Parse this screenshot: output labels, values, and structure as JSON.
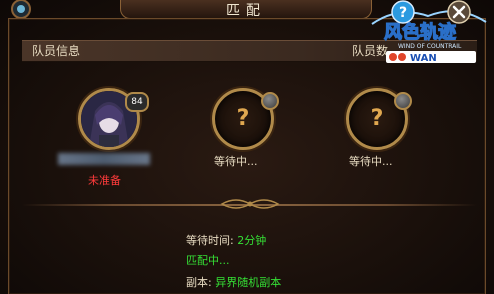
{
  "window": {
    "title": "匹配"
  },
  "section": {
    "title": "队员信息",
    "right_text": "队员数"
  },
  "slots": [
    {
      "level": "84",
      "status": "未准备"
    },
    {
      "label": "等待中..."
    },
    {
      "label": "等待中..."
    }
  ],
  "info": {
    "wait_label": "等待时间:",
    "wait_value": "2分钟",
    "matching": "匹配中...",
    "dungeon_label": "副本:",
    "dungeon_value": "异界随机副本"
  },
  "logo": {
    "title": "风色轨迹",
    "subtitle": "WIND OF COUNTRAIL",
    "brand": "PPWAN"
  },
  "colors": {
    "accent": "#b08a4a",
    "status_red": "#ff3b3b",
    "status_green": "#35e035"
  },
  "icons": {
    "help": "question-icon",
    "close": "close-icon"
  }
}
